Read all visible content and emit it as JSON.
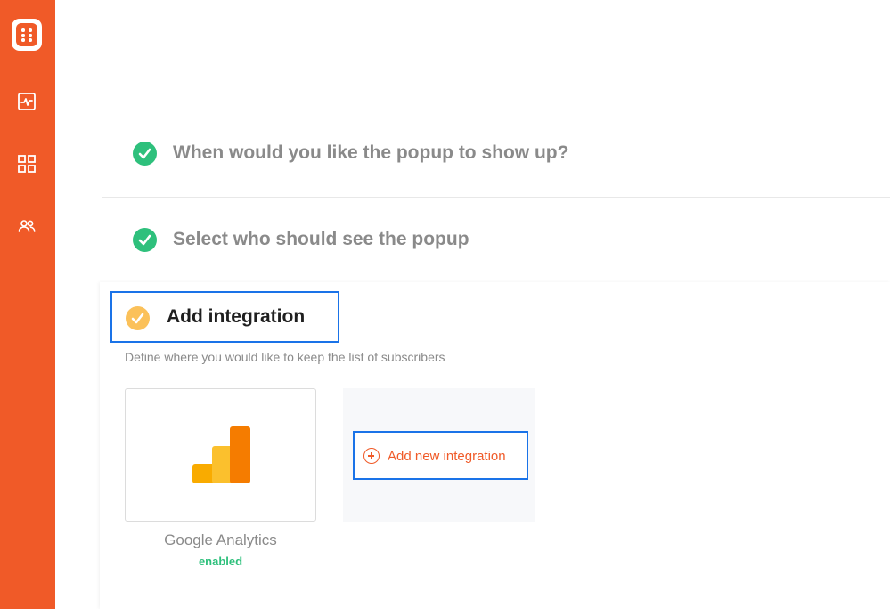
{
  "colors": {
    "brand": "#f05a28",
    "success": "#2ec07c",
    "warning": "#fbc15a",
    "focus": "#1a73e8"
  },
  "sidebar": {
    "icons": [
      "app-logo-icon",
      "activity-icon",
      "grid-icon",
      "users-icon"
    ]
  },
  "steps": [
    {
      "title": "When would you like the popup to show up?",
      "state": "completed"
    },
    {
      "title": "Select who should see the popup",
      "state": "completed"
    }
  ],
  "active_step": {
    "title": "Add integration",
    "description": "Define where you would like to keep the list of subscribers"
  },
  "integrations": [
    {
      "name": "Google Analytics",
      "status": "enabled",
      "icon": "google-analytics-icon"
    }
  ],
  "add_integration": {
    "label": "Add new integration",
    "icon": "plus-circle-icon"
  }
}
